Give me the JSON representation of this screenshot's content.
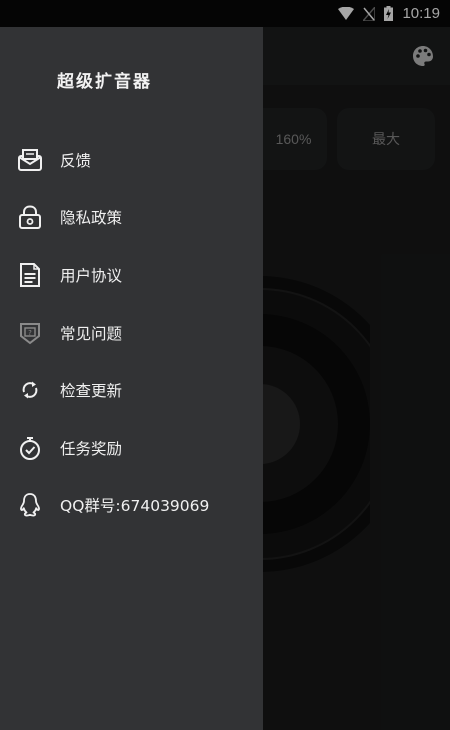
{
  "status_bar": {
    "time": "10:19",
    "icons": [
      "wifi-icon",
      "no-signal-icon",
      "battery-charging-icon"
    ]
  },
  "app": {
    "toolbar_icon": "palette-icon",
    "level_options": [
      "160%",
      "最大"
    ],
    "visual": "speaker-icon"
  },
  "drawer": {
    "title": "超级扩音器",
    "items": [
      {
        "label": "反馈",
        "icon": "feedback-mail-icon"
      },
      {
        "label": "隐私政策",
        "icon": "lock-icon"
      },
      {
        "label": "用户协议",
        "icon": "document-icon"
      },
      {
        "label": "常见问题",
        "icon": "faq-shield-icon"
      },
      {
        "label": "检查更新",
        "icon": "refresh-icon"
      },
      {
        "label": "任务奖励",
        "icon": "stopwatch-check-icon"
      },
      {
        "label": "QQ群号:674039069",
        "icon": "qq-penguin-icon"
      }
    ]
  }
}
